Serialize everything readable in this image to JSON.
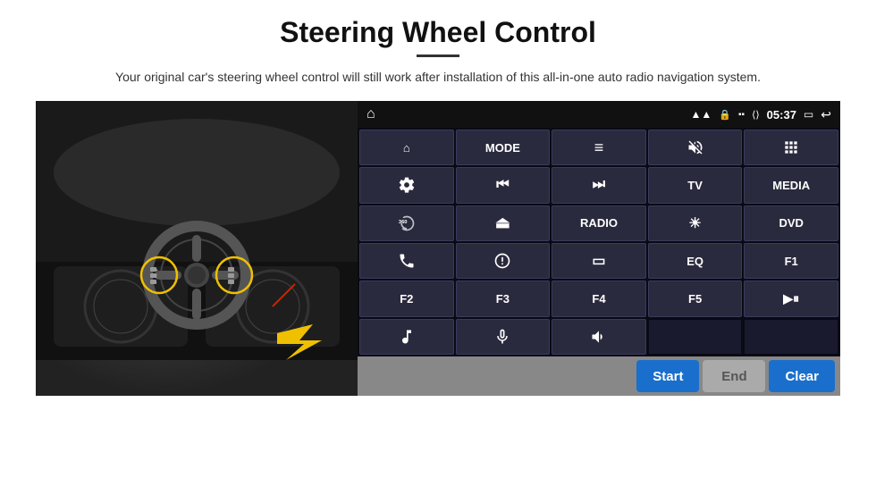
{
  "page": {
    "title": "Steering Wheel Control",
    "subtitle": "Your original car's steering wheel control will still work after installation of this all-in-one auto radio navigation system.",
    "divider": true
  },
  "status_bar": {
    "time": "05:37",
    "icons": [
      "wifi",
      "lock",
      "sd",
      "bluetooth",
      "screenshot",
      "back"
    ]
  },
  "button_rows": [
    [
      {
        "icon": "home",
        "label": "",
        "type": "icon"
      },
      {
        "icon": "",
        "label": "MODE",
        "type": "text"
      },
      {
        "icon": "list",
        "label": "",
        "type": "icon"
      },
      {
        "icon": "mute",
        "label": "",
        "type": "icon"
      },
      {
        "icon": "apps",
        "label": "",
        "type": "icon"
      }
    ],
    [
      {
        "icon": "settings",
        "label": "",
        "type": "icon"
      },
      {
        "icon": "prev",
        "label": "",
        "type": "icon"
      },
      {
        "icon": "next",
        "label": "",
        "type": "icon"
      },
      {
        "icon": "",
        "label": "TV",
        "type": "text"
      },
      {
        "icon": "",
        "label": "MEDIA",
        "type": "text"
      }
    ],
    [
      {
        "icon": "360car",
        "label": "",
        "type": "icon"
      },
      {
        "icon": "eject",
        "label": "",
        "type": "icon"
      },
      {
        "icon": "",
        "label": "RADIO",
        "type": "text"
      },
      {
        "icon": "brightness",
        "label": "",
        "type": "icon"
      },
      {
        "icon": "",
        "label": "DVD",
        "type": "text"
      }
    ],
    [
      {
        "icon": "phone",
        "label": "",
        "type": "icon"
      },
      {
        "icon": "swirl",
        "label": "",
        "type": "icon"
      },
      {
        "icon": "screen",
        "label": "",
        "type": "icon"
      },
      {
        "icon": "",
        "label": "EQ",
        "type": "text"
      },
      {
        "icon": "",
        "label": "F1",
        "type": "text"
      }
    ],
    [
      {
        "icon": "",
        "label": "F2",
        "type": "text"
      },
      {
        "icon": "",
        "label": "F3",
        "type": "text"
      },
      {
        "icon": "",
        "label": "F4",
        "type": "text"
      },
      {
        "icon": "",
        "label": "F5",
        "type": "text"
      },
      {
        "icon": "playpause",
        "label": "",
        "type": "icon"
      }
    ],
    [
      {
        "icon": "music",
        "label": "",
        "type": "icon"
      },
      {
        "icon": "mic",
        "label": "",
        "type": "icon"
      },
      {
        "icon": "vol",
        "label": "",
        "type": "icon"
      },
      {
        "icon": "",
        "label": "",
        "type": "empty"
      },
      {
        "icon": "",
        "label": "",
        "type": "empty"
      }
    ]
  ],
  "action_bar": {
    "start_label": "Start",
    "end_label": "End",
    "clear_label": "Clear"
  }
}
